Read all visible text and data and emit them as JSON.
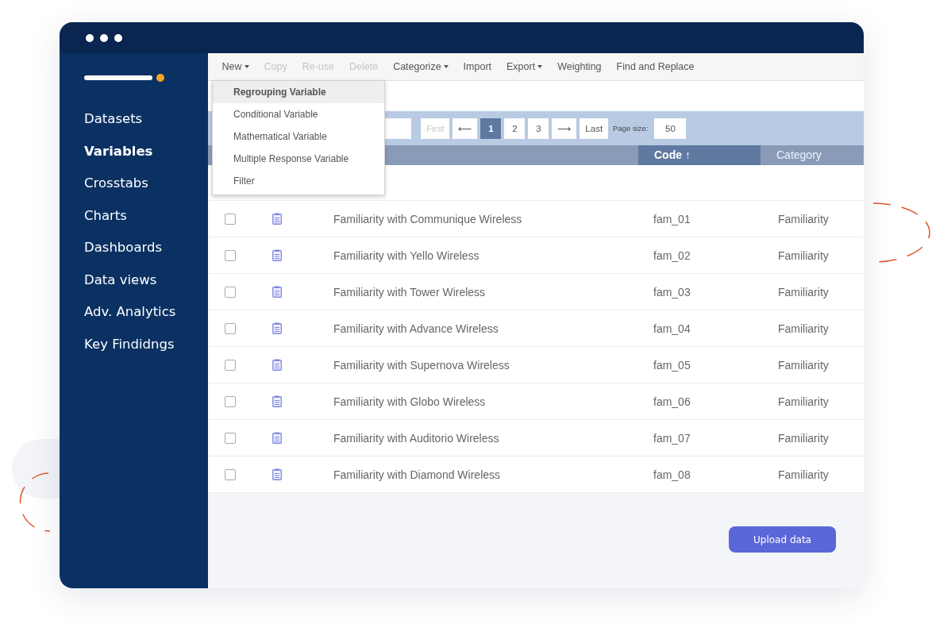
{
  "sidebar": {
    "items": [
      {
        "label": "Datasets",
        "selected": false
      },
      {
        "label": "Variables",
        "selected": true
      },
      {
        "label": "Crosstabs",
        "selected": false
      },
      {
        "label": "Charts",
        "selected": false
      },
      {
        "label": "Dashboards",
        "selected": false
      },
      {
        "label": "Data views",
        "selected": false
      },
      {
        "label": "Adv. Analytics",
        "selected": false
      },
      {
        "label": "Key Findidngs",
        "selected": false
      }
    ]
  },
  "toolbar": [
    {
      "label": "New",
      "menu": true,
      "disabled": false
    },
    {
      "label": "Copy",
      "menu": false,
      "disabled": true
    },
    {
      "label": "Re-use",
      "menu": false,
      "disabled": true
    },
    {
      "label": "Delete",
      "menu": false,
      "disabled": true
    },
    {
      "label": "Categorize",
      "menu": true,
      "disabled": false
    },
    {
      "label": "Import",
      "menu": false,
      "disabled": false
    },
    {
      "label": "Export",
      "menu": true,
      "disabled": false
    },
    {
      "label": "Weighting",
      "menu": false,
      "disabled": false
    },
    {
      "label": "Find and Replace",
      "menu": false,
      "disabled": false
    }
  ],
  "new_menu": [
    {
      "label": "Regrouping Variable",
      "selected": true
    },
    {
      "label": "Conditional Variable",
      "selected": false
    },
    {
      "label": "Mathematical Variable",
      "selected": false
    },
    {
      "label": "Multiple Response Variable",
      "selected": false
    },
    {
      "label": "Filter",
      "selected": false
    }
  ],
  "pager": {
    "buttons": [
      {
        "label": "First",
        "selected": false,
        "disabled": true
      },
      {
        "label": "⟵",
        "selected": false,
        "disabled": false
      },
      {
        "label": "1",
        "selected": true,
        "disabled": false
      },
      {
        "label": "2",
        "selected": false,
        "disabled": false
      },
      {
        "label": "3",
        "selected": false,
        "disabled": false
      },
      {
        "label": "⟶",
        "selected": false,
        "disabled": false
      },
      {
        "label": "Last",
        "selected": false,
        "disabled": false
      }
    ],
    "page_size_label": "Page size:",
    "page_size": "50"
  },
  "table": {
    "columns": [
      {
        "label": "Code ↑",
        "sorted": true
      },
      {
        "label": "Category",
        "sorted": false
      }
    ],
    "rows": [
      {
        "checked": false,
        "name": "Familiarity with Communique Wireless",
        "code": "fam_01",
        "category": "Familiarity"
      },
      {
        "checked": false,
        "name": "Familiarity with Yello Wireless",
        "code": "fam_02",
        "category": "Familiarity"
      },
      {
        "checked": false,
        "name": "Familiarity with Tower Wireless",
        "code": "fam_03",
        "category": "Familiarity"
      },
      {
        "checked": false,
        "name": "Familiarity with Advance Wireless",
        "code": "fam_04",
        "category": "Familiarity"
      },
      {
        "checked": false,
        "name": "Familiarity with Supernova Wireless",
        "code": "fam_05",
        "category": "Familiarity"
      },
      {
        "checked": false,
        "name": "Familiarity with Globo Wireless",
        "code": "fam_06",
        "category": "Familiarity"
      },
      {
        "checked": false,
        "name": "Familiarity with Auditorio Wireless",
        "code": "fam_07",
        "category": "Familiarity"
      },
      {
        "checked": false,
        "name": "Familiarity with Diamond Wireless",
        "code": "fam_08",
        "category": "Familiarity"
      }
    ]
  },
  "upload_button": "Upload data"
}
